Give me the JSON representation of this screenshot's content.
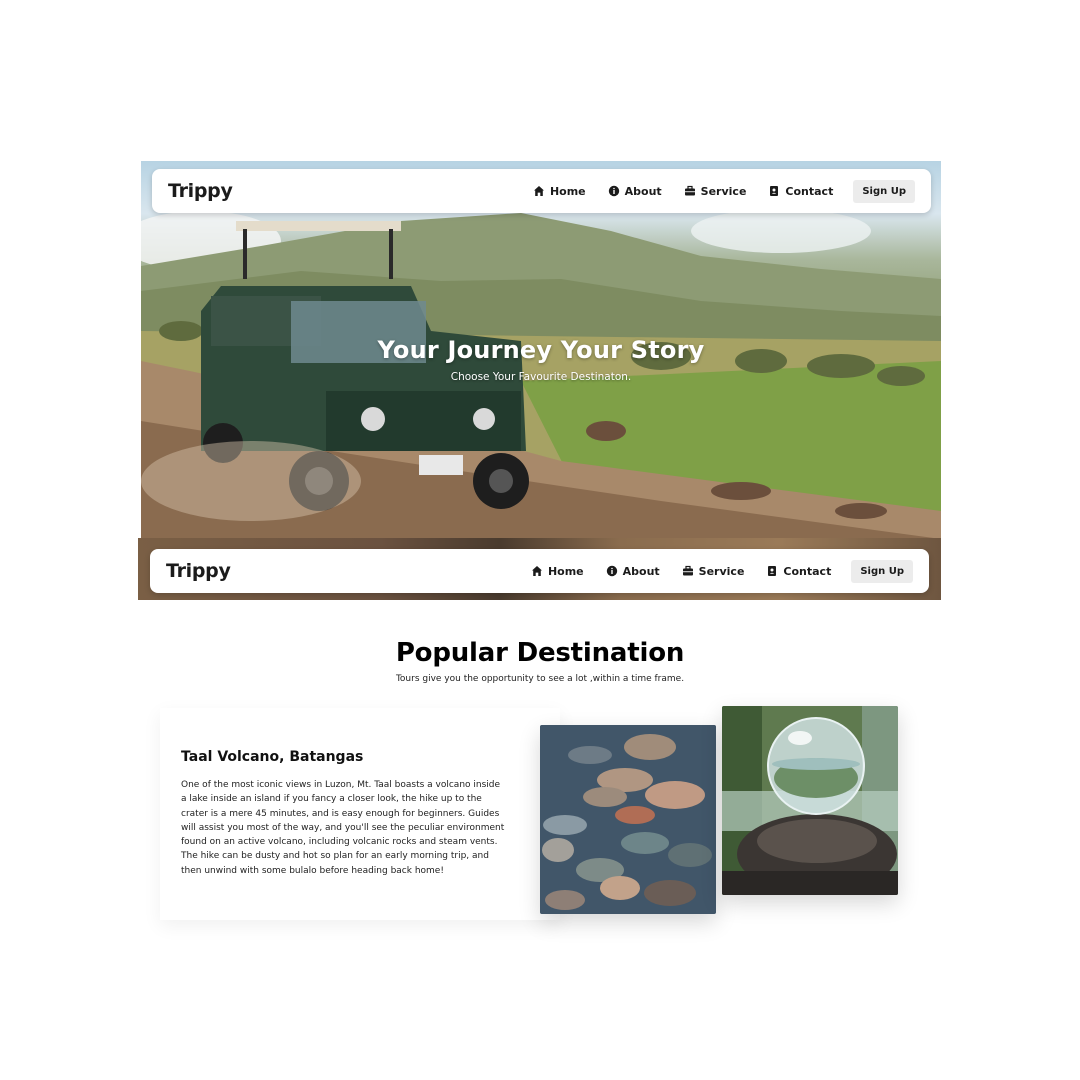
{
  "header": {
    "brand": "Trippy",
    "nav": [
      {
        "label": "Home",
        "icon": "home-icon"
      },
      {
        "label": "About",
        "icon": "info-icon"
      },
      {
        "label": "Service",
        "icon": "briefcase-icon"
      },
      {
        "label": "Contact",
        "icon": "contact-book-icon"
      }
    ],
    "signup_label": "Sign Up"
  },
  "hero": {
    "title": "Your Journey Your Story",
    "subtitle": "Choose Your Favourite Destinaton."
  },
  "destinations": {
    "title": "Popular Destination",
    "subtitle": "Tours give you the opportunity to see a lot ,within a time frame.",
    "card": {
      "title": "Taal Volcano, Batangas",
      "text": "One of the most iconic views in Luzon, Mt. Taal boasts a volcano inside a lake inside an island if you fancy a closer look, the hike up to the crater is a mere 45 minutes, and is easy enough for beginners. Guides will assist you most of the way, and you'll see the peculiar environment found on an active volcano, including volcanic rocks and steam vents. The hike can be dusty and hot so plan for an early morning trip, and then unwind with some bulalo before heading back home!"
    }
  },
  "colors": {
    "navbar_bg": "#ffffff",
    "signup_bg": "#ececec",
    "text_dark": "#1b1b1b",
    "hero_text": "#ffffff"
  }
}
